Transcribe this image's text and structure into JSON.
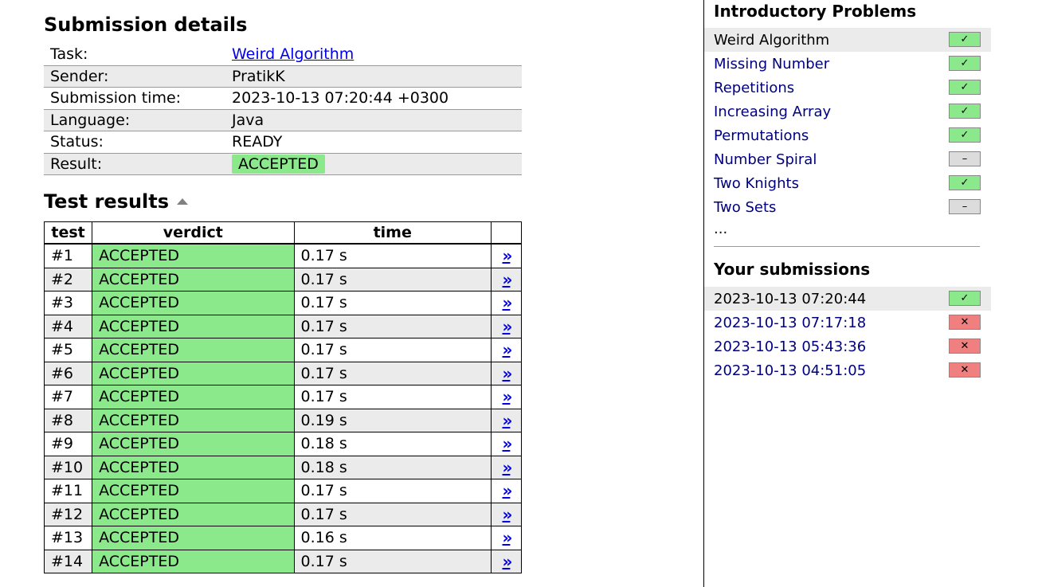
{
  "details": {
    "title": "Submission details",
    "rows": [
      {
        "key": "Task:",
        "value": "Weird Algorithm"
      },
      {
        "key": "Sender:",
        "value": "PratikK"
      },
      {
        "key": "Submission time:",
        "value": "2023-10-13 07:20:44 +0300"
      },
      {
        "key": "Language:",
        "value": "Java"
      },
      {
        "key": "Status:",
        "value": "READY"
      },
      {
        "key": "Result:",
        "value": "ACCEPTED"
      }
    ]
  },
  "tests": {
    "title": "Test results",
    "headers": [
      "test",
      "verdict",
      "time"
    ],
    "link_glyph": "»",
    "rows": [
      {
        "test": "#1",
        "verdict": "ACCEPTED",
        "time": "0.17 s"
      },
      {
        "test": "#2",
        "verdict": "ACCEPTED",
        "time": "0.17 s"
      },
      {
        "test": "#3",
        "verdict": "ACCEPTED",
        "time": "0.17 s"
      },
      {
        "test": "#4",
        "verdict": "ACCEPTED",
        "time": "0.17 s"
      },
      {
        "test": "#5",
        "verdict": "ACCEPTED",
        "time": "0.17 s"
      },
      {
        "test": "#6",
        "verdict": "ACCEPTED",
        "time": "0.17 s"
      },
      {
        "test": "#7",
        "verdict": "ACCEPTED",
        "time": "0.17 s"
      },
      {
        "test": "#8",
        "verdict": "ACCEPTED",
        "time": "0.19 s"
      },
      {
        "test": "#9",
        "verdict": "ACCEPTED",
        "time": "0.18 s"
      },
      {
        "test": "#10",
        "verdict": "ACCEPTED",
        "time": "0.18 s"
      },
      {
        "test": "#11",
        "verdict": "ACCEPTED",
        "time": "0.17 s"
      },
      {
        "test": "#12",
        "verdict": "ACCEPTED",
        "time": "0.17 s"
      },
      {
        "test": "#13",
        "verdict": "ACCEPTED",
        "time": "0.16 s"
      },
      {
        "test": "#14",
        "verdict": "ACCEPTED",
        "time": "0.17 s"
      }
    ]
  },
  "sidebar": {
    "problems_title": "Introductory Problems",
    "problems": [
      {
        "label": "Weird Algorithm",
        "status": "ok",
        "current": true
      },
      {
        "label": "Missing Number",
        "status": "ok"
      },
      {
        "label": "Repetitions",
        "status": "ok"
      },
      {
        "label": "Increasing Array",
        "status": "ok"
      },
      {
        "label": "Permutations",
        "status": "ok"
      },
      {
        "label": "Number Spiral",
        "status": "none"
      },
      {
        "label": "Two Knights",
        "status": "ok"
      },
      {
        "label": "Two Sets",
        "status": "none"
      }
    ],
    "ellipsis": "...",
    "submissions_title": "Your submissions",
    "submissions": [
      {
        "label": "2023-10-13 07:20:44",
        "status": "ok",
        "current": true
      },
      {
        "label": "2023-10-13 07:17:18",
        "status": "bad"
      },
      {
        "label": "2023-10-13 05:43:36",
        "status": "bad"
      },
      {
        "label": "2023-10-13 04:51:05",
        "status": "bad"
      }
    ]
  },
  "icons": {
    "ok": "check-icon",
    "bad": "cross-icon",
    "none": "dash-icon"
  },
  "glyphs": {
    "ok": "✓",
    "bad": "✕",
    "none": "–"
  },
  "colors": {
    "accepted": "#8be88b",
    "rejected": "#f08080",
    "untried": "#dcdcdc",
    "link": "#0000ee",
    "nav_link": "#000080"
  }
}
